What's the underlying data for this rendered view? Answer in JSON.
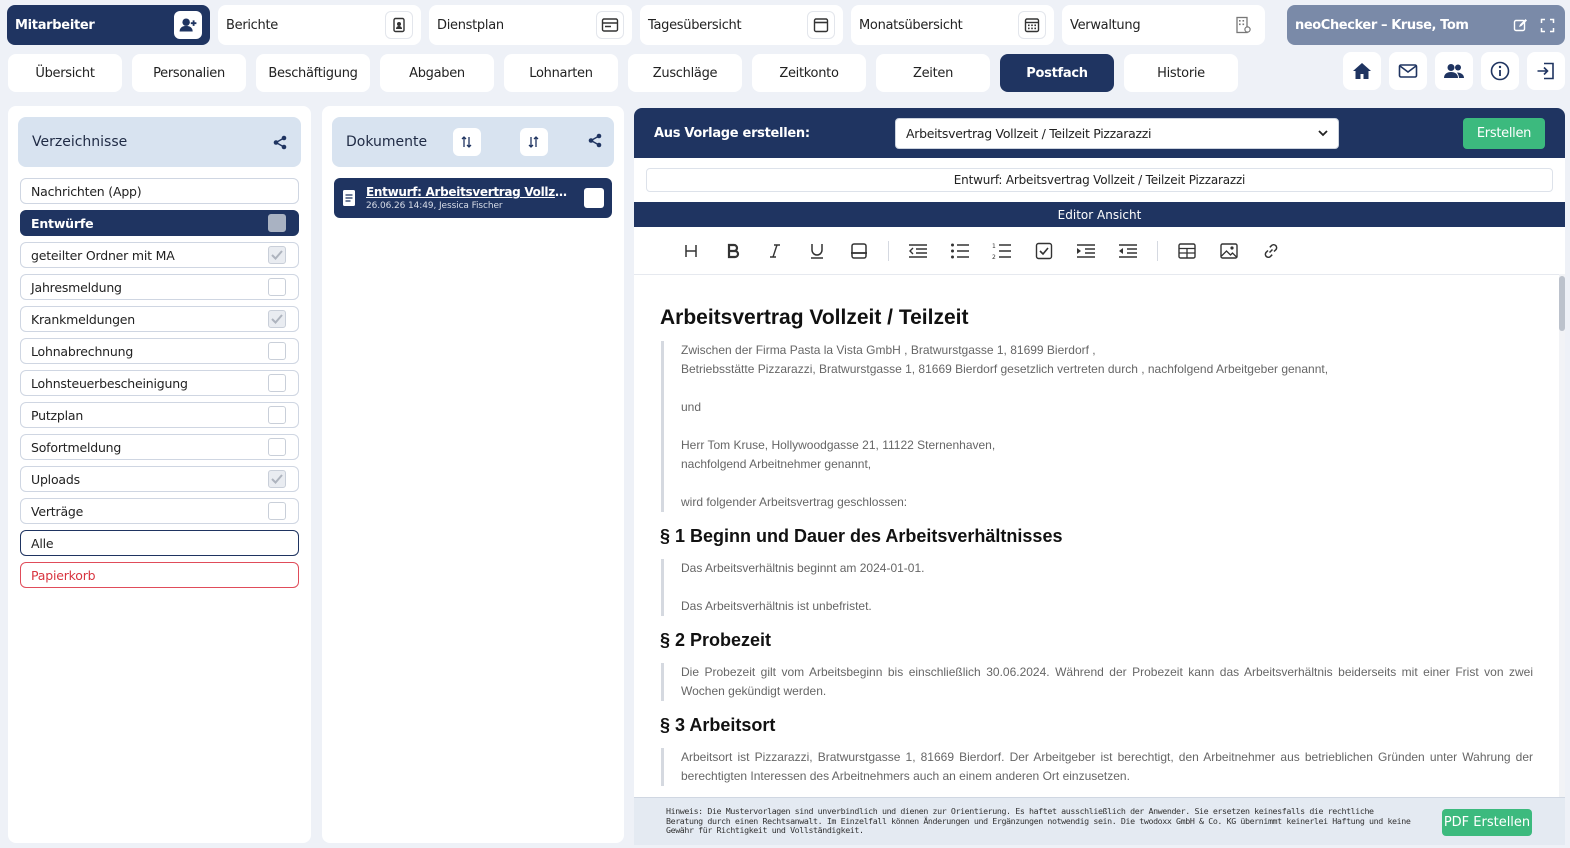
{
  "modules": [
    {
      "label": "Mitarbeiter",
      "icon": "user-add-icon",
      "active": true
    },
    {
      "label": "Berichte",
      "icon": "report-icon"
    },
    {
      "label": "Dienstplan",
      "icon": "schedule-icon"
    },
    {
      "label": "Tagesübersicht",
      "icon": "day-calendar-icon"
    },
    {
      "label": "Monatsübersicht",
      "icon": "month-calendar-icon"
    },
    {
      "label": "Verwaltung",
      "icon": "building-icon"
    }
  ],
  "user": {
    "label": "neoChecker – Kruse, Tom"
  },
  "tabs": [
    "Übersicht",
    "Personalien",
    "Beschäftigung",
    "Abgaben",
    "Lohnarten",
    "Zuschläge",
    "Zeitkonto",
    "Zeiten",
    "Postfach",
    "Historie"
  ],
  "active_tab": "Postfach",
  "directories": {
    "title": "Verzeichnisse",
    "items": [
      {
        "label": "Nachrichten (App)",
        "checkbox": false
      },
      {
        "label": "Entwürfe",
        "checkbox": true,
        "checked": false,
        "selected": true
      },
      {
        "label": "geteilter Ordner mit MA",
        "checkbox": true,
        "checked": true
      },
      {
        "label": "Jahresmeldung",
        "checkbox": true,
        "checked": false
      },
      {
        "label": "Krankmeldungen",
        "checkbox": true,
        "checked": true
      },
      {
        "label": "Lohnabrechnung",
        "checkbox": true,
        "checked": false
      },
      {
        "label": "Lohnsteuerbescheinigung",
        "checkbox": true,
        "checked": false
      },
      {
        "label": "Putzplan",
        "checkbox": true,
        "checked": false
      },
      {
        "label": "Sofortmeldung",
        "checkbox": true,
        "checked": false
      },
      {
        "label": "Uploads",
        "checkbox": true,
        "checked": true
      },
      {
        "label": "Verträge",
        "checkbox": true,
        "checked": false
      }
    ],
    "all_label": "Alle",
    "trash_label": "Papierkorb"
  },
  "documents": {
    "title": "Dokumente",
    "items": [
      {
        "title": "Entwurf: Arbeitsvertrag Vollzeit / Teilzeit Pizzarazzi",
        "meta": "26.06.26 14:49, Jessica Fischer"
      }
    ]
  },
  "editor": {
    "template_label": "Aus Vorlage erstellen:",
    "template_value": "Arbeitsvertrag Vollzeit / Teilzeit Pizzarazzi",
    "create_label": "Erstellen",
    "doc_title": "Entwurf: Arbeitsvertrag Vollzeit / Teilzeit Pizzarazzi",
    "view_label": "Editor Ansicht",
    "pdf_label": "PDF Erstellen",
    "hint": "Hinweis: Die Mustervorlagen sind unverbindlich und dienen zur Orientierung. Es haftet ausschließlich der Anwender. Sie ersetzen keinesfalls die rechtliche Beratung durch einen Rechtsanwalt. Im Einzelfall können Änderungen und Ergänzungen notwendig sein. Die twodoxx GmbH & Co. KG übernimmt keinerlei Haftung und keine Gewähr für Richtigkeit und Vollständigkeit."
  },
  "content": {
    "title": "Arbeitsvertrag Vollzeit / Teilzeit",
    "intro": [
      "Zwischen der Firma Pasta la Vista GmbH , Bratwurstgasse 1, 81699 Bierdorf ,",
      "Betriebsstätte Pizzarazzi, Bratwurstgasse 1, 81669 Bierdorf gesetzlich vertreten durch , nachfolgend Arbeitgeber genannt,",
      "und",
      "Herr Tom Kruse, Hollywoodgasse 21, 11122 Sternenhaven,",
      "nachfolgend Arbeitnehmer genannt,",
      "wird folgender Arbeitsvertrag geschlossen:"
    ],
    "s1_title": "§ 1 Beginn und Dauer des Arbeitsverhältnisses",
    "s1": [
      "Das Arbeitsverhältnis beginnt am 2024-01-01.",
      "Das Arbeitsverhältnis ist unbefristet."
    ],
    "s2_title": "§ 2 Probezeit",
    "s2": "Die Probezeit gilt vom Arbeitsbeginn bis einschließlich 30.06.2024. Während der Probezeit kann das Arbeitsverhältnis beiderseits mit einer Frist von zwei Wochen gekündigt werden.",
    "s3_title": "§ 3 Arbeitsort",
    "s3": "Arbeitsort ist Pizzarazzi, Bratwurstgasse 1, 81669 Bierdorf. Der Arbeitgeber ist berechtigt, den Arbeitnehmer aus betrieblichen Gründen unter Wahrung der berechtigten Interessen des Arbeitnehmers auch an einem anderen Ort einzusetzen."
  }
}
